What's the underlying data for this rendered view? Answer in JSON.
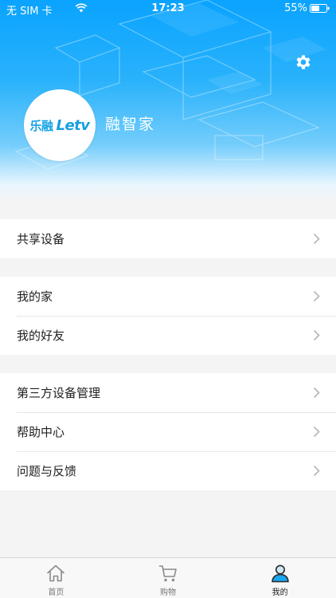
{
  "status_bar": {
    "carrier": "无 SIM 卡",
    "time": "17:23",
    "battery": "55%",
    "battery_level": 0.55
  },
  "profile": {
    "avatar_text_cn": "乐融",
    "avatar_text_en": "Letv",
    "name": "融智家"
  },
  "menu_groups": [
    {
      "items": [
        {
          "label": "共享设备"
        }
      ]
    },
    {
      "items": [
        {
          "label": "我的家"
        },
        {
          "label": "我的好友"
        }
      ]
    },
    {
      "items": [
        {
          "label": "第三方设备管理"
        },
        {
          "label": "帮助中心"
        },
        {
          "label": "问题与反馈"
        }
      ]
    }
  ],
  "tabbar": {
    "tabs": [
      {
        "label": "首页",
        "icon": "home-icon"
      },
      {
        "label": "购物",
        "icon": "cart-icon"
      },
      {
        "label": "我的",
        "icon": "user-icon",
        "active": true
      }
    ]
  },
  "colors": {
    "accent": "#1aa6f0"
  }
}
